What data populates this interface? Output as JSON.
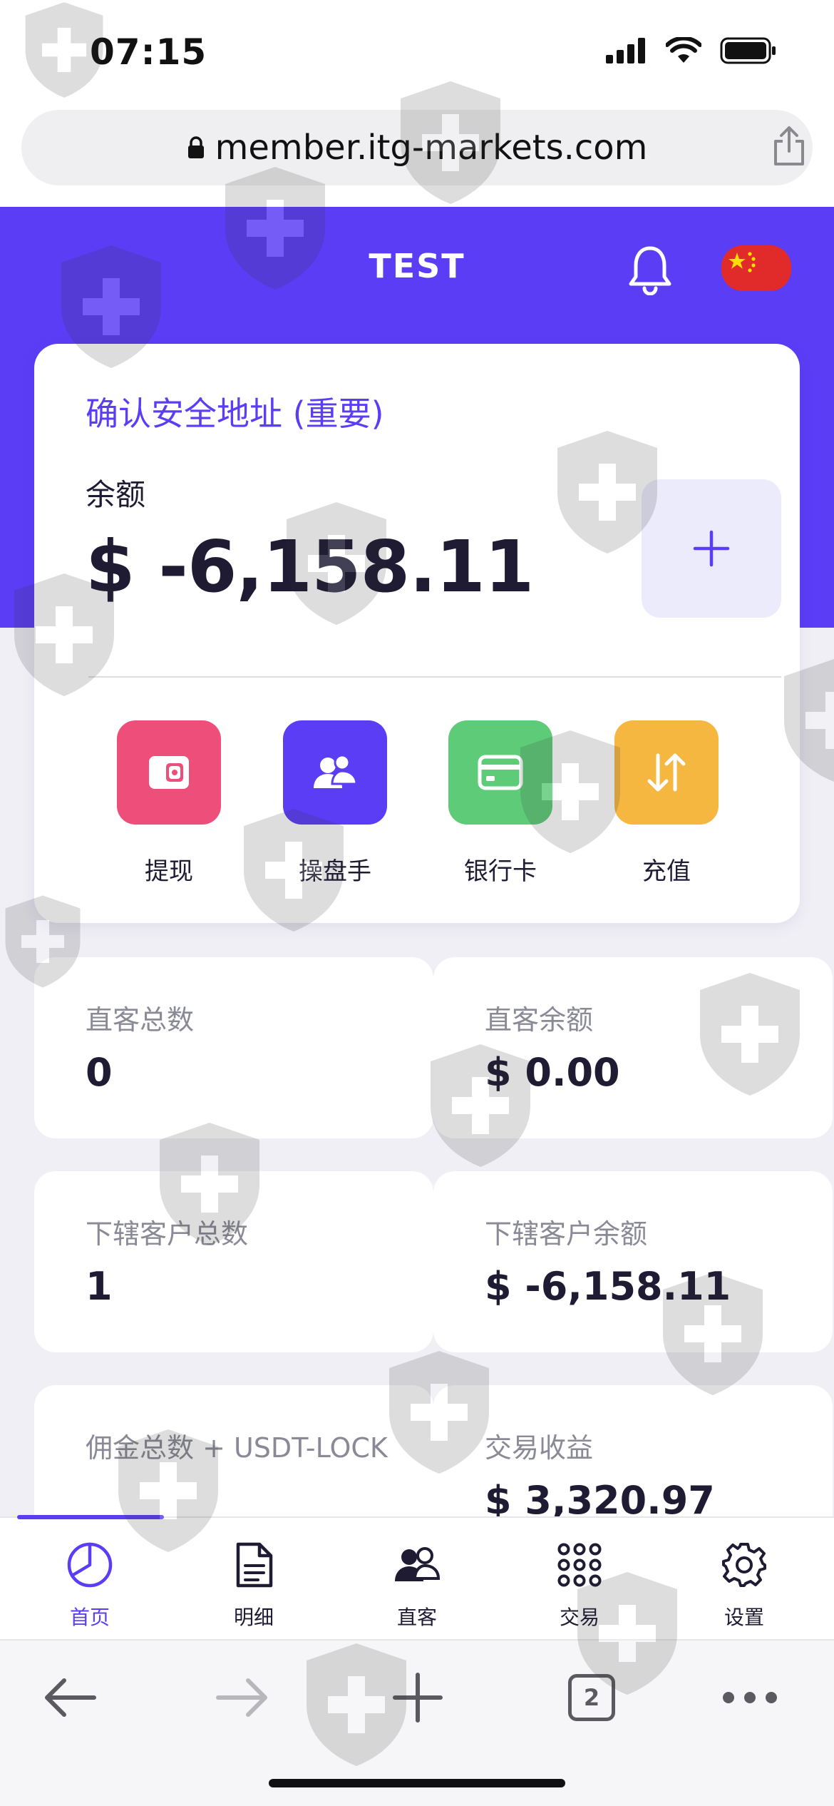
{
  "status_bar": {
    "time": "07:15"
  },
  "browser": {
    "url": "member.itg-markets.com",
    "tab_count": "2"
  },
  "header": {
    "title": "TEST"
  },
  "balance_card": {
    "confirm_link": "确认安全地址 (重要)",
    "balance_label": "余额",
    "balance_value": "$ -6,158.11"
  },
  "actions": [
    {
      "label": "提现",
      "icon": "wallet-icon",
      "color": "#ee4e7a"
    },
    {
      "label": "操盘手",
      "icon": "traders-icon",
      "color": "#5b3df5"
    },
    {
      "label": "银行卡",
      "icon": "bank-card-icon",
      "color": "#5ecb78"
    },
    {
      "label": "充值",
      "icon": "transfer-arrows-icon",
      "color": "#f5b740"
    }
  ],
  "stats": [
    {
      "label": "直客总数",
      "value": "0"
    },
    {
      "label": "直客余额",
      "value": "$ 0.00"
    },
    {
      "label": "下辖客户总数",
      "value": "1"
    },
    {
      "label": "下辖客户余额",
      "value": "$ -6,158.11"
    },
    {
      "label": "佣金总数 + USDT-LOCK",
      "value": ""
    },
    {
      "label": "交易收益",
      "value": "$ 3,320.97"
    }
  ],
  "tabs": [
    {
      "label": "首页",
      "icon": "pie-chart-icon",
      "active": true
    },
    {
      "label": "明细",
      "icon": "document-icon",
      "active": false
    },
    {
      "label": "直客",
      "icon": "clients-icon",
      "active": false
    },
    {
      "label": "交易",
      "icon": "grid-dots-icon",
      "active": false
    },
    {
      "label": "设置",
      "icon": "gear-icon",
      "active": false
    }
  ],
  "colors": {
    "brand": "#5b3df5",
    "background": "#f0eff5",
    "text": "#1e1b33",
    "muted": "#8a8a96"
  }
}
